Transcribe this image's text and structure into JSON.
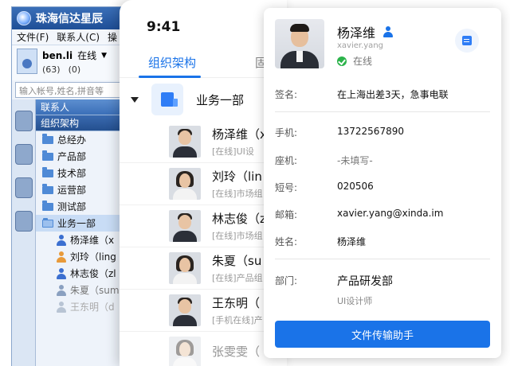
{
  "desktop": {
    "title": "珠海信达星辰",
    "menu": [
      "文件(F)",
      "联系人(C)",
      "操"
    ],
    "user": {
      "name": "ben.li",
      "status": "在线",
      "count_a": "(63)",
      "count_b": "(0)"
    },
    "search_placeholder": "输入帐号,姓名,拼音等",
    "section_contacts": "联系人",
    "section_org": "组织架构",
    "folders": [
      "总经办",
      "产品部",
      "技术部",
      "运营部",
      "测试部"
    ],
    "open_folder": "业务一部",
    "members": [
      {
        "label": "杨泽维（x",
        "color": "#3b6fd0"
      },
      {
        "label": "刘玲（ling",
        "color": "#e89a3a"
      },
      {
        "label": "林志俊（zl",
        "color": "#3b6fd0"
      },
      {
        "label": "朱夏（summ",
        "color": "#8aa0c0"
      },
      {
        "label": "王东明（d",
        "color": "#b8c4d4"
      }
    ]
  },
  "mobile": {
    "time": "9:41",
    "tab_active": "组织架构",
    "tab_other": "固",
    "dept": "业务一部",
    "people": [
      {
        "name": "杨泽维（x",
        "sub": "[在线]UI设",
        "g": "m"
      },
      {
        "name": "刘玲（lin",
        "sub": "[在线]市场组",
        "g": "f"
      },
      {
        "name": "林志俊（z",
        "sub": "[在线]市场组",
        "g": "m"
      },
      {
        "name": "朱夏（su",
        "sub": "[在线]产品组",
        "g": "f"
      },
      {
        "name": "王东明（",
        "sub": "[手机在线]产",
        "g": "m"
      },
      {
        "name": "张雯雯（",
        "sub": "",
        "g": "f"
      }
    ]
  },
  "card": {
    "name": "杨泽维",
    "english": "xavier.yang",
    "status": "在线",
    "signature_label": "签名:",
    "signature": "在上海出差3天，急事电联",
    "mobile_label": "手机:",
    "mobile": "13722567890",
    "phone_label": "座机:",
    "phone": "-未填写-",
    "short_label": "短号:",
    "short": "020506",
    "email_label": "邮箱:",
    "email": "xavier.yang@xinda.im",
    "fullname_label": "姓名:",
    "fullname": "杨泽维",
    "dept_label": "部门:",
    "dept": "产品研发部",
    "job": "UI设计师",
    "action": "文件传输助手"
  }
}
